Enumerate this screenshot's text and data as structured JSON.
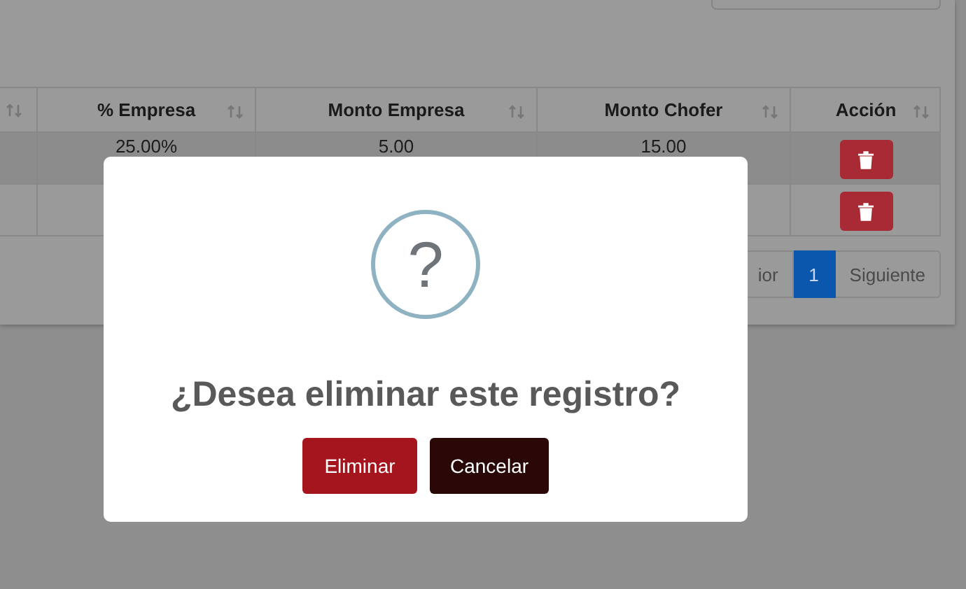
{
  "table": {
    "columns": [
      "% Empresa",
      "Monto Empresa",
      "Monto Chofer",
      "Acción"
    ],
    "rows": [
      {
        "values": [
          "25.00%",
          "5.00",
          "15.00"
        ],
        "striped": true
      },
      {
        "striped": false
      }
    ]
  },
  "pagination": [
    {
      "label": "ior",
      "selected": false
    },
    {
      "label": "1",
      "selected": true
    },
    {
      "label": "Siguiente",
      "selected": false
    }
  ],
  "dialog": {
    "icon": "?",
    "title": "¿Desea eliminar este registro?",
    "buttons": [
      {
        "label": "Eliminar",
        "kind": "confirm"
      },
      {
        "label": "Cancelar",
        "kind": "cancel"
      }
    ]
  }
}
